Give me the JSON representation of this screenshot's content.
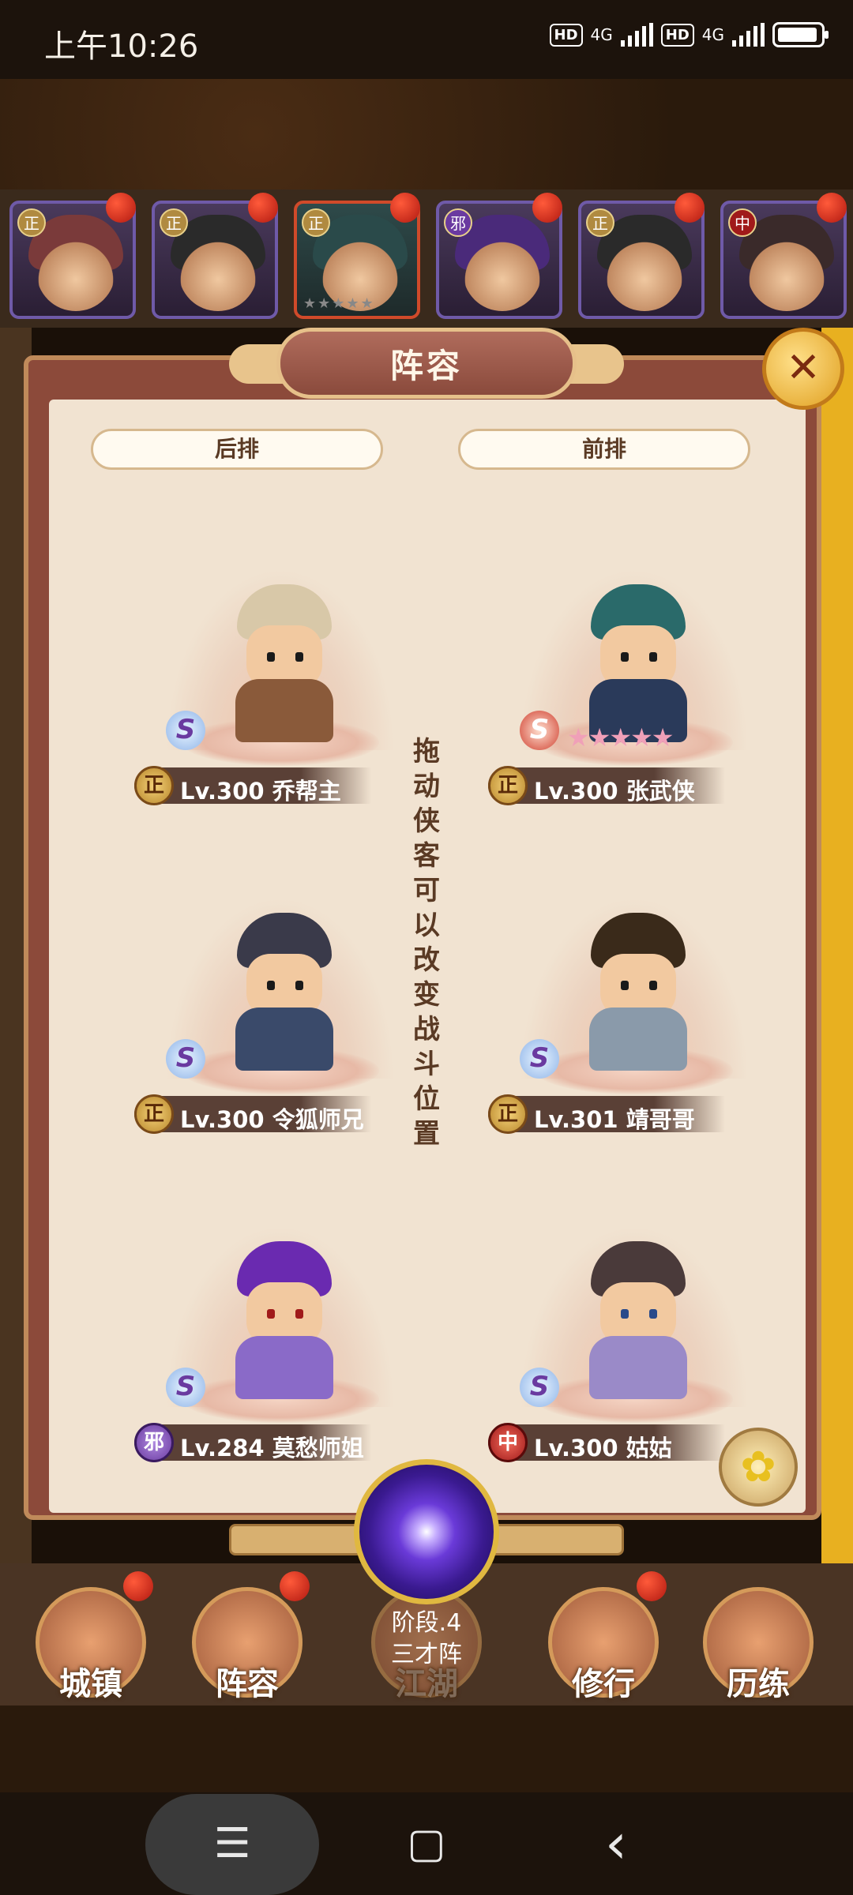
{
  "status_bar": {
    "time": "上午10:26",
    "network_1": "4G",
    "network_2": "4G",
    "hd_1": "HD",
    "hd_2": "HD",
    "battery_percent": 90
  },
  "hero_strip": {
    "slots": [
      {
        "faction": "正"
      },
      {
        "faction": "正"
      },
      {
        "faction": "正",
        "selected": true
      },
      {
        "faction": "邪"
      },
      {
        "faction": "正"
      },
      {
        "faction": "中"
      }
    ]
  },
  "panel": {
    "title": "阵容",
    "close_icon": "close-icon",
    "back_row_label": "后排",
    "front_row_label": "前排",
    "drag_hint": "拖动侠客可以改变战斗位置",
    "units": [
      {
        "faction": "正",
        "level": "Lv.300",
        "name": "乔帮主",
        "grade": "S"
      },
      {
        "faction": "正",
        "level": "Lv.300",
        "name": "张武侠",
        "grade": "S",
        "stars": "★★★★★"
      },
      {
        "faction": "正",
        "level": "Lv.300",
        "name": "令狐师兄",
        "grade": "S"
      },
      {
        "faction": "正",
        "level": "Lv.301",
        "name": "靖哥哥",
        "grade": "S"
      },
      {
        "faction": "邪",
        "level": "Lv.284",
        "name": "莫愁师姐",
        "grade": "S"
      },
      {
        "faction": "中",
        "level": "Lv.300",
        "name": "姑姑",
        "grade": "S"
      }
    ]
  },
  "formation": {
    "stage": "阶段.4",
    "name": "三才阵"
  },
  "bottom_nav": {
    "items": [
      "城镇",
      "阵容",
      "江湖",
      "修行",
      "历练"
    ]
  },
  "system_nav": {
    "menu": "☰",
    "home": "▢",
    "back": "‹"
  },
  "colors": {
    "panel_bg": "#f1e3d1",
    "panel_border": "#8c4a3a",
    "accent_gold": "#e0b840"
  }
}
